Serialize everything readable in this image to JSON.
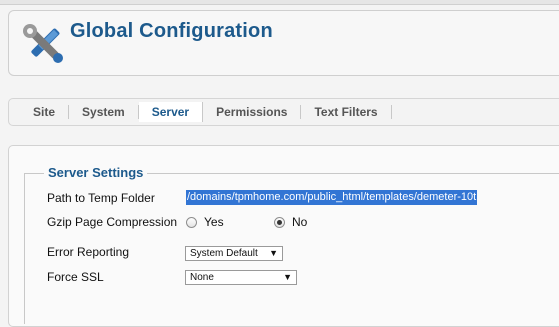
{
  "header": {
    "title": "Global Configuration",
    "icon": "tools-icon"
  },
  "tabs": [
    {
      "label": "Site"
    },
    {
      "label": "System"
    },
    {
      "label": "Server",
      "active": true
    },
    {
      "label": "Permissions"
    },
    {
      "label": "Text Filters"
    }
  ],
  "server_settings": {
    "legend": "Server Settings",
    "path_to_temp_folder": {
      "label": "Path to Temp Folder",
      "value": "/domains/tpmhome.com/public_html/templates/demeter-10t"
    },
    "gzip": {
      "label": "Gzip Page Compression",
      "options": [
        "Yes",
        "No"
      ],
      "selected": "No"
    },
    "error_reporting": {
      "label": "Error Reporting",
      "value": "System Default"
    },
    "force_ssl": {
      "label": "Force SSL",
      "value": "None"
    }
  },
  "colors": {
    "accent": "#1d5a8c",
    "selection": "#3275d4"
  }
}
